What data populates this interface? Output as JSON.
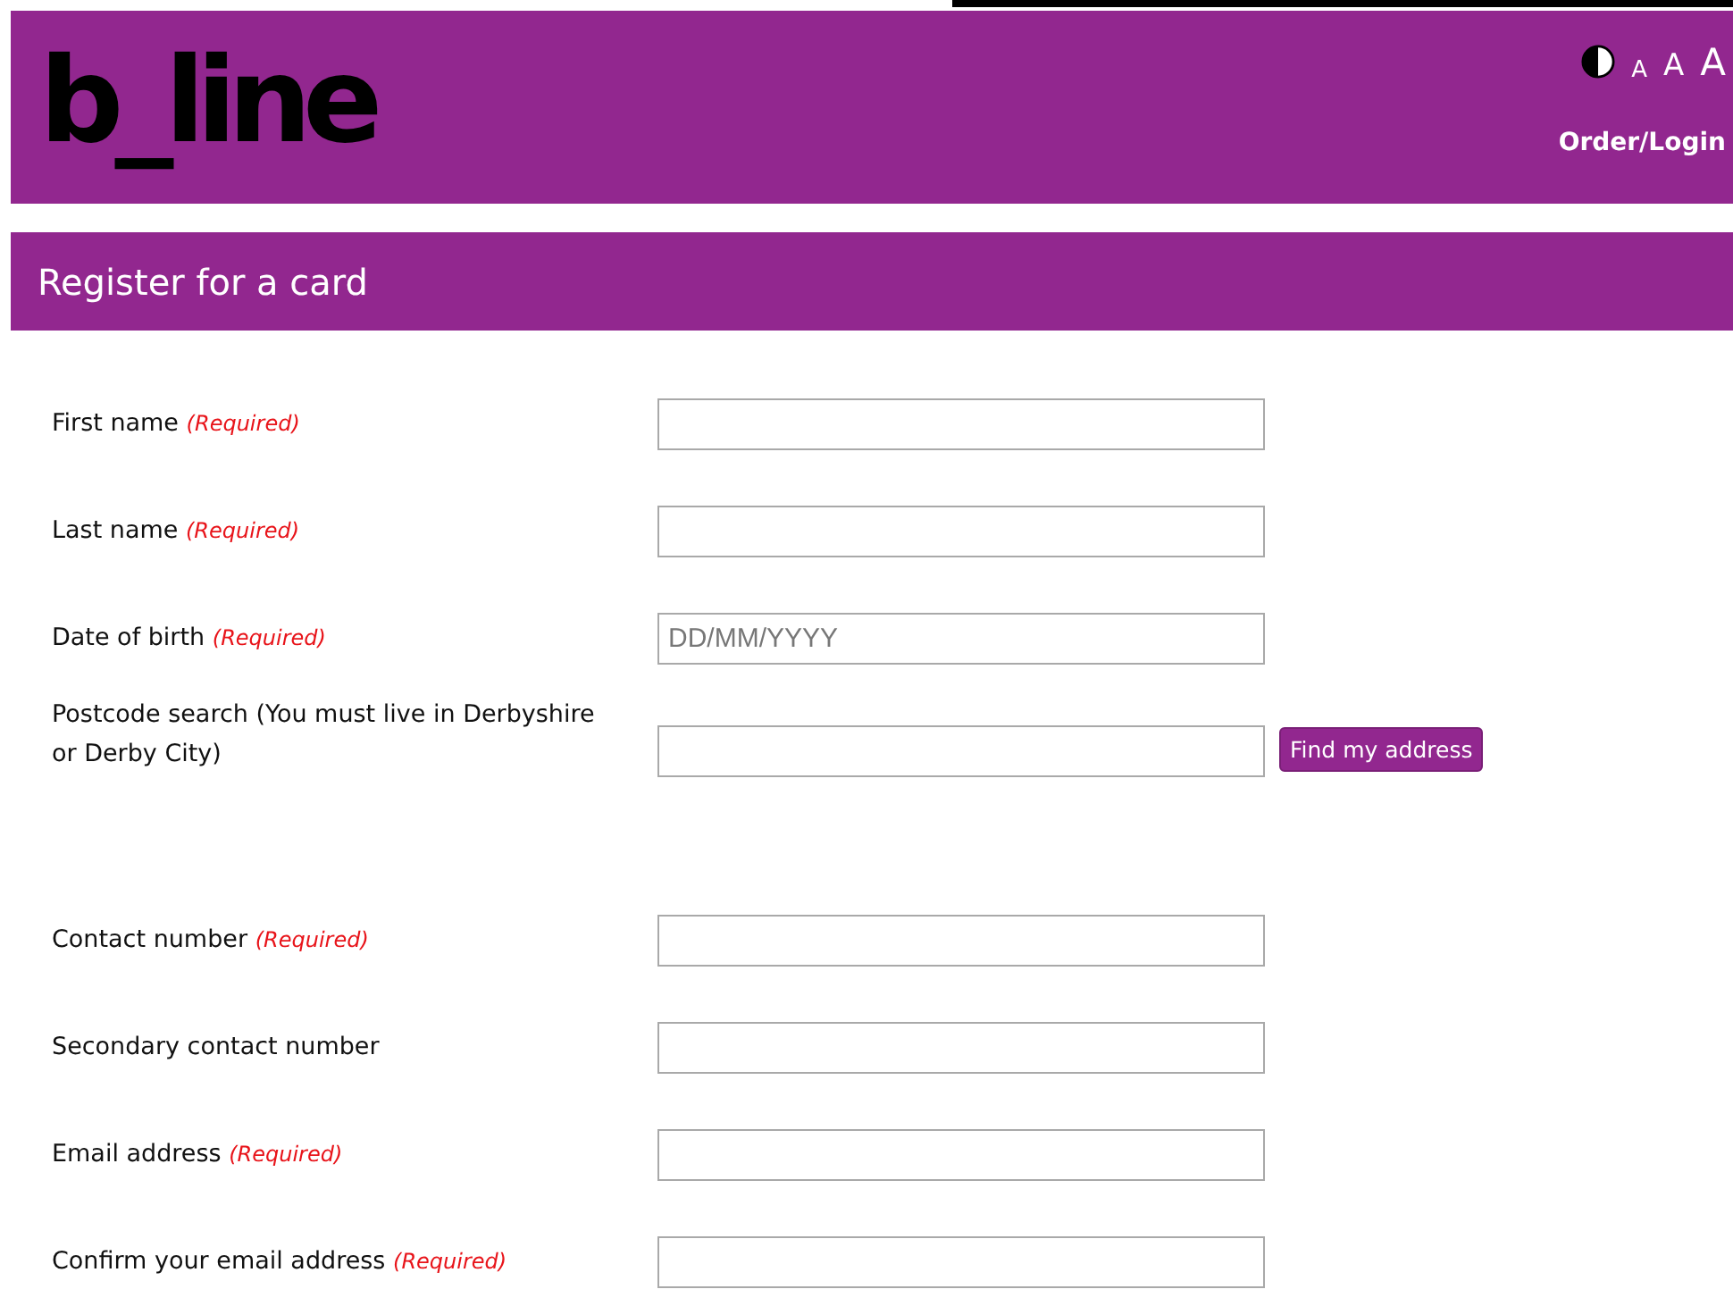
{
  "header": {
    "logo": "b_line",
    "text_size_options": [
      {
        "label": "A"
      },
      {
        "label": "A"
      },
      {
        "label": "A"
      }
    ],
    "login_link": "Order/Login"
  },
  "page_title": "Register for a card",
  "fields": [
    {
      "label": "First name",
      "note": "(Required)"
    },
    {
      "label": "Last name",
      "note": "(Required)"
    },
    {
      "label": "Date of birth",
      "note": "(Required)",
      "placeholder": "DD/MM/YYYY"
    },
    {
      "label": "Postcode search (You must live in Derbyshire or Derby City)",
      "button": "Find my address"
    },
    {
      "label": "Contact number",
      "note": "(Required)"
    },
    {
      "label": "Secondary contact number"
    },
    {
      "label": "Email address",
      "note": "(Required)"
    },
    {
      "label": "Confirm your email address",
      "note": "(Required)"
    }
  ]
}
